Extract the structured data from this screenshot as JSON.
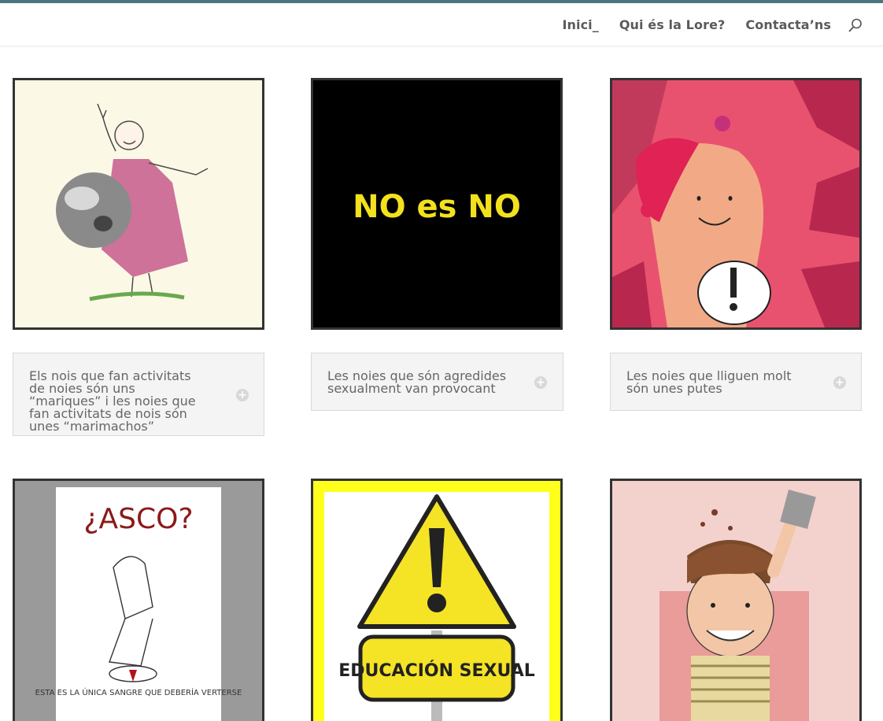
{
  "header": {
    "nav": [
      {
        "label": "Inici_"
      },
      {
        "label": "Qui és la Lore?"
      },
      {
        "label": "Contacta’ns"
      }
    ],
    "search_icon": "search-icon"
  },
  "cards": [
    {
      "image_text": "",
      "toggle_title": "Els nois que fan activitats de noies són uns “mariques” i les noies que fan activitats de nois són unes “marimachos”"
    },
    {
      "image_text": "NO es NO",
      "toggle_title": "Les noies que són agredides sexualment van provocant"
    },
    {
      "image_text": "",
      "toggle_title": "Les noies que lliguen molt són unes putes"
    },
    {
      "image_text": "¿ASCO?",
      "image_caption": "ESTA ES LA ÚNICA SANGRE QUE DEBERÍA VERTERSE"
    },
    {
      "image_text": "EDUCACIÓN SEXUAL"
    },
    {
      "image_text": ""
    }
  ],
  "colors": {
    "topline": "#4a7680",
    "border": "#333333",
    "toggle_bg": "#f4f4f4",
    "text": "#666666"
  }
}
